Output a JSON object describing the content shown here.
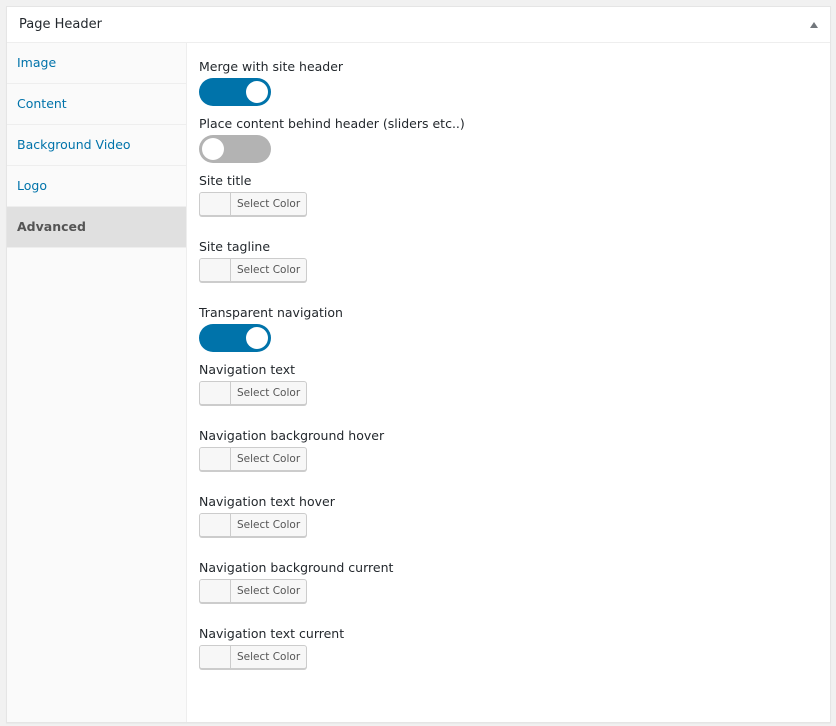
{
  "panel": {
    "title": "Page Header",
    "collapse_icon": "triangle-up-icon"
  },
  "sidebar": {
    "tabs": [
      {
        "label": "Image",
        "active": false
      },
      {
        "label": "Content",
        "active": false
      },
      {
        "label": "Background Video",
        "active": false
      },
      {
        "label": "Logo",
        "active": false
      },
      {
        "label": "Advanced",
        "active": true
      }
    ]
  },
  "colors": {
    "accent": "#0073aa",
    "toggle_off": "#b3b3b3",
    "active_tab_bg": "#e0e0e0"
  },
  "fields": [
    {
      "label": "Merge with site header",
      "type": "toggle",
      "value": true
    },
    {
      "label": "Place content behind header (sliders etc..)",
      "type": "toggle",
      "value": false
    },
    {
      "label": "Site title",
      "type": "color",
      "button_label": "Select Color"
    },
    {
      "label": "Site tagline",
      "type": "color",
      "button_label": "Select Color"
    },
    {
      "label": "Transparent navigation",
      "type": "toggle",
      "value": true
    },
    {
      "label": "Navigation text",
      "type": "color",
      "button_label": "Select Color"
    },
    {
      "label": "Navigation background hover",
      "type": "color",
      "button_label": "Select Color"
    },
    {
      "label": "Navigation text hover",
      "type": "color",
      "button_label": "Select Color"
    },
    {
      "label": "Navigation background current",
      "type": "color",
      "button_label": "Select Color"
    },
    {
      "label": "Navigation text current",
      "type": "color",
      "button_label": "Select Color"
    }
  ]
}
